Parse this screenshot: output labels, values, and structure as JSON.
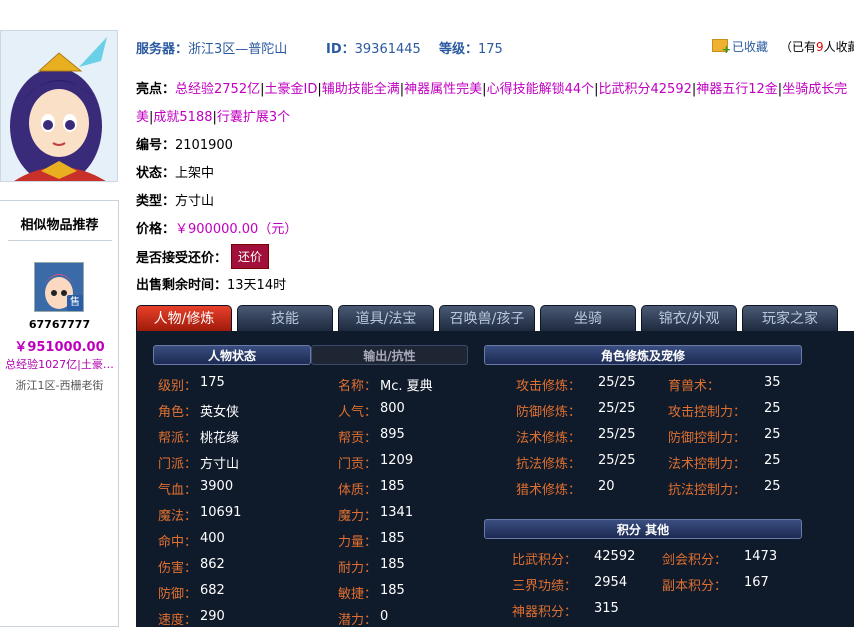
{
  "header": {
    "server_label": "服务器：",
    "server_value": "浙江3区—普陀山",
    "id_label": "ID：",
    "id_value": "39361445",
    "level_label": "等级：",
    "level_value": "175",
    "fav_label": "已收藏",
    "fav_prefix": "（已有",
    "fav_count": "9",
    "fav_suffix": "人收藏"
  },
  "highlights": {
    "label": "亮点：",
    "items": [
      "总经验2752亿",
      "土豪金ID",
      "辅助技能全满",
      "神器属性完美",
      "心得技能解锁44个",
      "比武积分42592",
      "神器五行12金",
      "坐骑成长完美",
      "成就5188",
      "行囊扩展3个"
    ]
  },
  "info": {
    "serial_label": "编号：",
    "serial_value": "2101900",
    "status_label": "状态：",
    "status_value": "上架中",
    "type_label": "类型：",
    "type_value": "方寸山",
    "price_label": "价格：",
    "price_value": "￥900000.00（元）",
    "offer_label": "是否接受还价：",
    "offer_button": "还价",
    "time_label": "出售剩余时间：",
    "time_value": "13天14时"
  },
  "similar": {
    "title": "相似物品推荐",
    "badge": "售",
    "id": "67767777",
    "price": "￥951000.00",
    "desc": "总经验1027亿|土豪…",
    "server": "浙江1区-西栅老街"
  },
  "tabs": [
    "人物/修炼",
    "技能",
    "道具/法宝",
    "召唤兽/孩子",
    "坐骑",
    "锦衣/外观",
    "玩家之家"
  ],
  "sections": {
    "char_status": "人物状态",
    "output_resist": "输出/抗性",
    "cultivation": "角色修炼及宠修",
    "points": "积分  其他"
  },
  "stats_left": [
    {
      "k": "级别：",
      "v": "175"
    },
    {
      "k": "角色：",
      "v": "英女侠"
    },
    {
      "k": "帮派：",
      "v": "桃花缘"
    },
    {
      "k": "门派：",
      "v": "方寸山"
    },
    {
      "k": "气血：",
      "v": "3900"
    },
    {
      "k": "魔法：",
      "v": "10691"
    },
    {
      "k": "命中：",
      "v": "400"
    },
    {
      "k": "伤害：",
      "v": "862"
    },
    {
      "k": "防御：",
      "v": "682"
    },
    {
      "k": "速度：",
      "v": "290"
    }
  ],
  "stats_mid": [
    {
      "k": "名称：",
      "v": "Mc. 夏典"
    },
    {
      "k": "人气：",
      "v": "800"
    },
    {
      "k": "帮贡：",
      "v": "895"
    },
    {
      "k": "门贡：",
      "v": "1209"
    },
    {
      "k": "体质：",
      "v": "185"
    },
    {
      "k": "魔力：",
      "v": "1341"
    },
    {
      "k": "力量：",
      "v": "185"
    },
    {
      "k": "耐力：",
      "v": "185"
    },
    {
      "k": "敏捷：",
      "v": "185"
    },
    {
      "k": "潜力：",
      "v": "0"
    }
  ],
  "cult_left": [
    {
      "k": "攻击修炼：",
      "v": "25/25"
    },
    {
      "k": "防御修炼：",
      "v": "25/25"
    },
    {
      "k": "法术修炼：",
      "v": "25/25"
    },
    {
      "k": "抗法修炼：",
      "v": "25/25"
    },
    {
      "k": "猎术修炼：",
      "v": "20"
    }
  ],
  "cult_right": [
    {
      "k": "育兽术：",
      "v": "35"
    },
    {
      "k": "攻击控制力：",
      "v": "25"
    },
    {
      "k": "防御控制力：",
      "v": "25"
    },
    {
      "k": "法术控制力：",
      "v": "25"
    },
    {
      "k": "抗法控制力：",
      "v": "25"
    }
  ],
  "points_left": [
    {
      "k": "比武积分：",
      "v": "42592"
    },
    {
      "k": "三界功绩：",
      "v": "2954"
    },
    {
      "k": "神器积分：",
      "v": "315"
    }
  ],
  "points_right": [
    {
      "k": "剑会积分：",
      "v": "1473"
    },
    {
      "k": "副本积分：",
      "v": "167"
    }
  ]
}
